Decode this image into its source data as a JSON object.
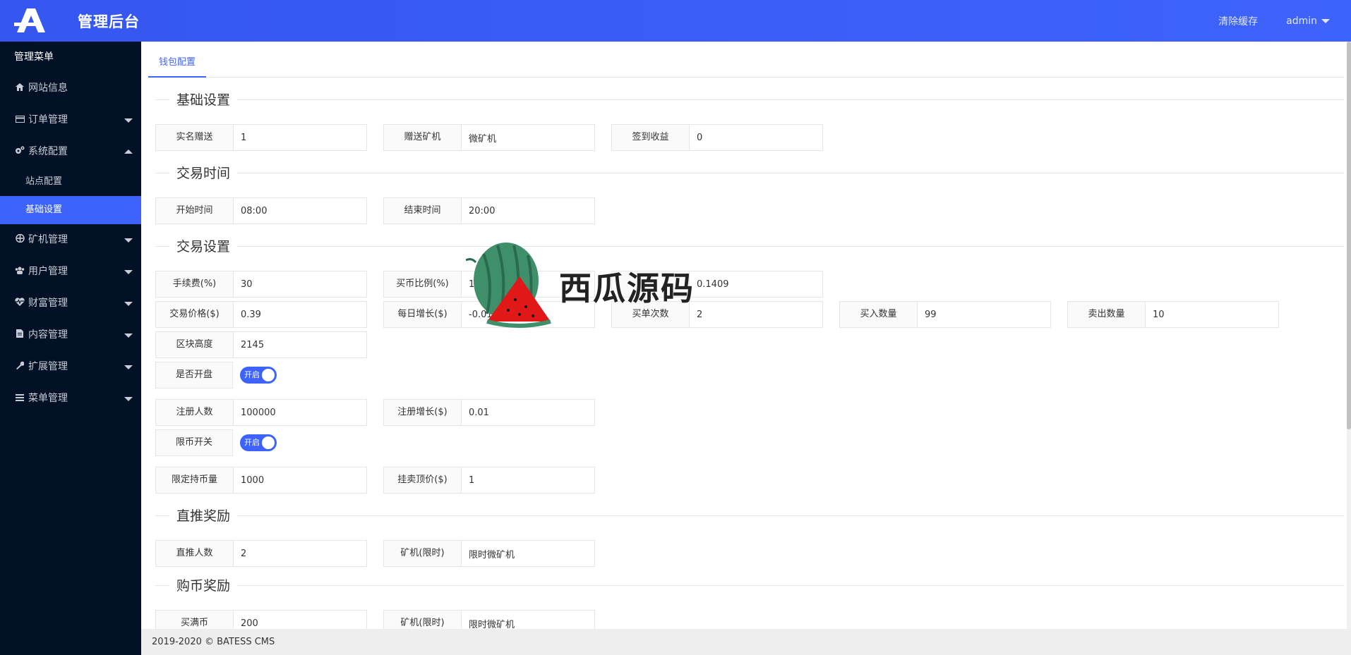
{
  "header": {
    "title": "管理后台",
    "clear_cache": "清除缓存",
    "user": "admin"
  },
  "sidebar": {
    "heading": "管理菜单",
    "items": [
      {
        "label": "网站信息",
        "icon": "home-icon"
      },
      {
        "label": "订单管理",
        "icon": "credit-card-icon"
      },
      {
        "label": "系统配置",
        "icon": "cogs-icon"
      },
      {
        "label": "矿机管理",
        "icon": "ship-icon"
      },
      {
        "label": "用户管理",
        "icon": "users-icon"
      },
      {
        "label": "财富管理",
        "icon": "heartbeat-icon"
      },
      {
        "label": "内容管理",
        "icon": "file-icon"
      },
      {
        "label": "扩展管理",
        "icon": "wrench-icon"
      },
      {
        "label": "菜单管理",
        "icon": "bars-icon"
      }
    ],
    "sub_items": [
      {
        "label": "站点配置"
      },
      {
        "label": "基础设置"
      }
    ]
  },
  "tabs": [
    {
      "label": "钱包配置"
    }
  ],
  "sections": {
    "basic": "基础设置",
    "trade_time": "交易时间",
    "trade_settings": "交易设置",
    "direct_reward": "直推奖励",
    "buy_reward": "购币奖励"
  },
  "fields": {
    "realname_gift": {
      "label": "实名赠送",
      "value": "1"
    },
    "gift_miner": {
      "label": "赠送矿机",
      "value": "微矿机"
    },
    "signin_income": {
      "label": "签到收益",
      "value": "0"
    },
    "start_time": {
      "label": "开始时间",
      "value": "08:00"
    },
    "end_time": {
      "label": "结束时间",
      "value": "20:00"
    },
    "fee": {
      "label": "手续费(%)",
      "value": "30"
    },
    "buy_ratio": {
      "label": "买币比例(%)",
      "value": "10"
    },
    "ratio_extra": {
      "value": "0.1409"
    },
    "trade_price": {
      "label": "交易价格($)",
      "value": "0.39"
    },
    "daily_growth": {
      "label": "每日增长($)",
      "value": "-0.01"
    },
    "buy_times": {
      "label": "买单次数",
      "value": "2"
    },
    "buy_amount": {
      "label": "买入数量",
      "value": "99"
    },
    "sell_amount": {
      "label": "卖出数量",
      "value": "10"
    },
    "block_height": {
      "label": "区块高度",
      "value": "2145"
    },
    "register_count": {
      "label": "注册人数",
      "value": "100000"
    },
    "register_growth": {
      "label": "注册增长($)",
      "value": "0.01"
    },
    "limit_hold": {
      "label": "限定持币量",
      "value": "1000"
    },
    "sell_top_price": {
      "label": "挂卖顶价($)",
      "value": "1"
    },
    "direct_count": {
      "label": "直推人数",
      "value": "2"
    },
    "miner_limited_1": {
      "label": "矿机(限时)",
      "value": "限时微矿机"
    },
    "buy_full": {
      "label": "买满币",
      "value": "200"
    },
    "miner_limited_2": {
      "label": "矿机(限时)",
      "value": "限时微矿机"
    }
  },
  "switches": {
    "market_open": {
      "label": "是否开盘",
      "state": "开启"
    },
    "limit_switch": {
      "label": "限币开关",
      "state": "开启"
    }
  },
  "watermark": {
    "text": "西瓜源码"
  },
  "footer": {
    "text": "2019-2020 © BATESS CMS"
  },
  "colors": {
    "accent": "#3e63fb",
    "sidebar_bg": "#031126"
  }
}
